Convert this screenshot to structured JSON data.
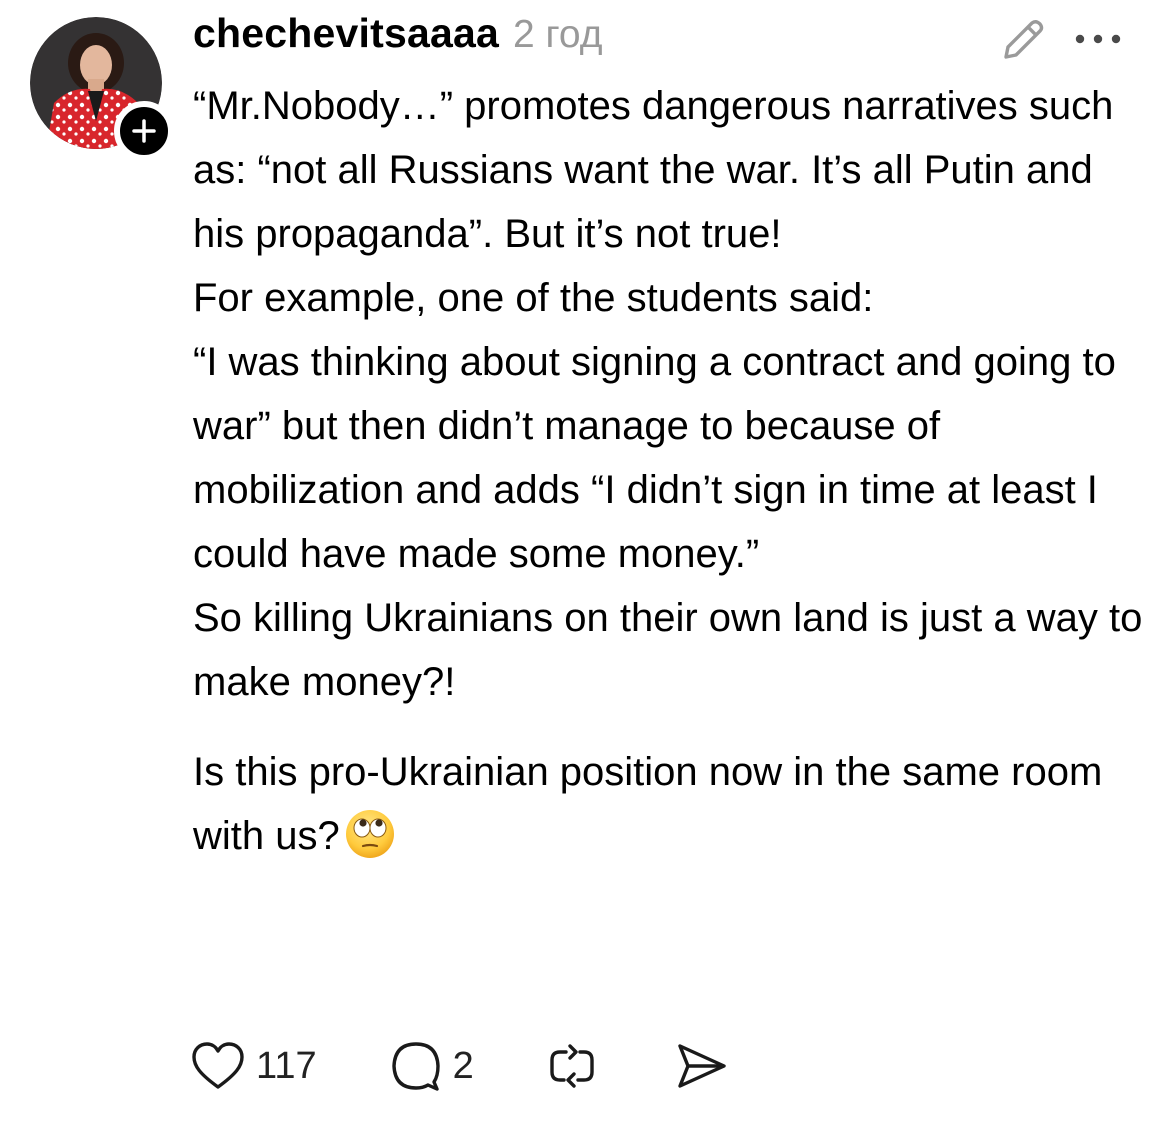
{
  "post": {
    "author": "chechevitsaaaa",
    "timestamp": "2 год",
    "paragraphs": [
      "“Mr.Nobody…” promotes dangerous narratives such as: “not all Russians want the war. It’s all Putin and his propaganda”. But it’s not true!",
      "For example, one of the students said:",
      "“I was thinking about signing a contract and going to war” but then didn’t manage to because of mobilization and adds “I didn’t sign in time at least I could have made some money.”",
      "So killing Ukrainians on their own land is just a way to make money?!"
    ],
    "final_paragraph": "Is this pro-Ukrainian position now in the same room with us?",
    "emoji": "face-with-rolling-eyes"
  },
  "actions": {
    "likes": "117",
    "replies": "2"
  },
  "icons": {
    "follow": "plus-icon",
    "edit": "pencil-icon",
    "more": "more-dots-icon",
    "like": "heart-icon",
    "reply": "comment-bubble-icon",
    "repost": "repost-icon",
    "share": "send-icon"
  },
  "colors": {
    "text": "#000000",
    "muted": "#999999",
    "avatar_outfit": "#d8262c"
  }
}
